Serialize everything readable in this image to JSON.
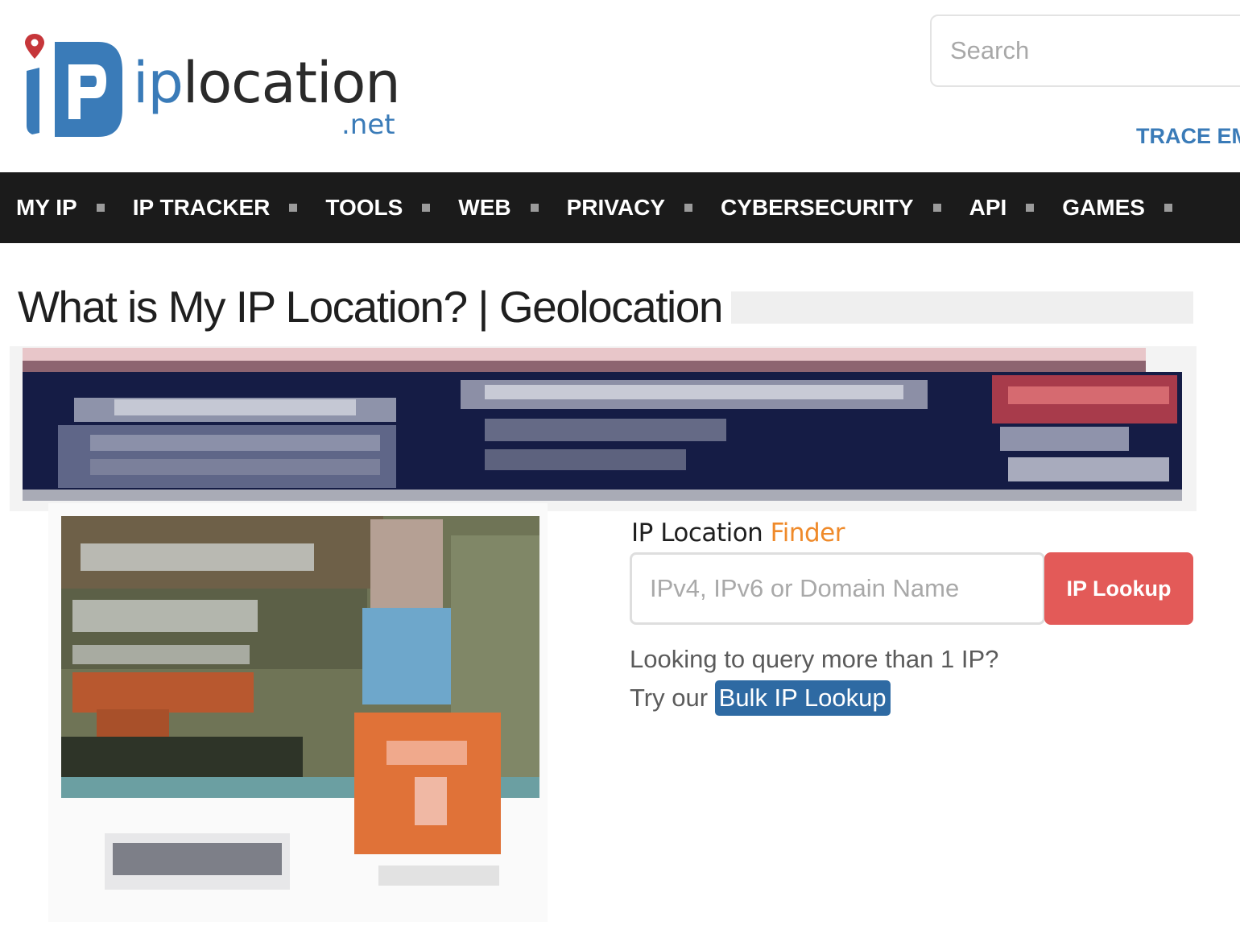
{
  "header": {
    "logo": {
      "ip_text": "ip",
      "word_text": "location",
      "tld_text": ".net"
    },
    "search": {
      "placeholder": "Search"
    },
    "trace_link": "TRACE EMAIL"
  },
  "nav": {
    "items": [
      {
        "label": "MY IP"
      },
      {
        "label": "IP TRACKER"
      },
      {
        "label": "TOOLS"
      },
      {
        "label": "WEB"
      },
      {
        "label": "PRIVACY"
      },
      {
        "label": "CYBERSECURITY"
      },
      {
        "label": "API"
      },
      {
        "label": "GAMES"
      }
    ]
  },
  "page": {
    "title": "What is My IP Location? | Geolocation"
  },
  "finder": {
    "title_main": "IP Location ",
    "title_accent": "Finder",
    "input_placeholder": "IPv4, IPv6 or Domain Name",
    "button_label": "IP Lookup",
    "bulk_line1": "Looking to query more than 1 IP?",
    "bulk_prefix": "Try our ",
    "bulk_link": "Bulk IP Lookup"
  },
  "colors": {
    "brand_blue": "#3a7bb8",
    "nav_bg": "#1b1b1b",
    "lookup_red": "#e35a58",
    "accent_orange": "#ef8a2a",
    "bulk_link_bg": "#2e6aa3"
  },
  "icons": {
    "logo_pin": "map-pin-icon"
  }
}
